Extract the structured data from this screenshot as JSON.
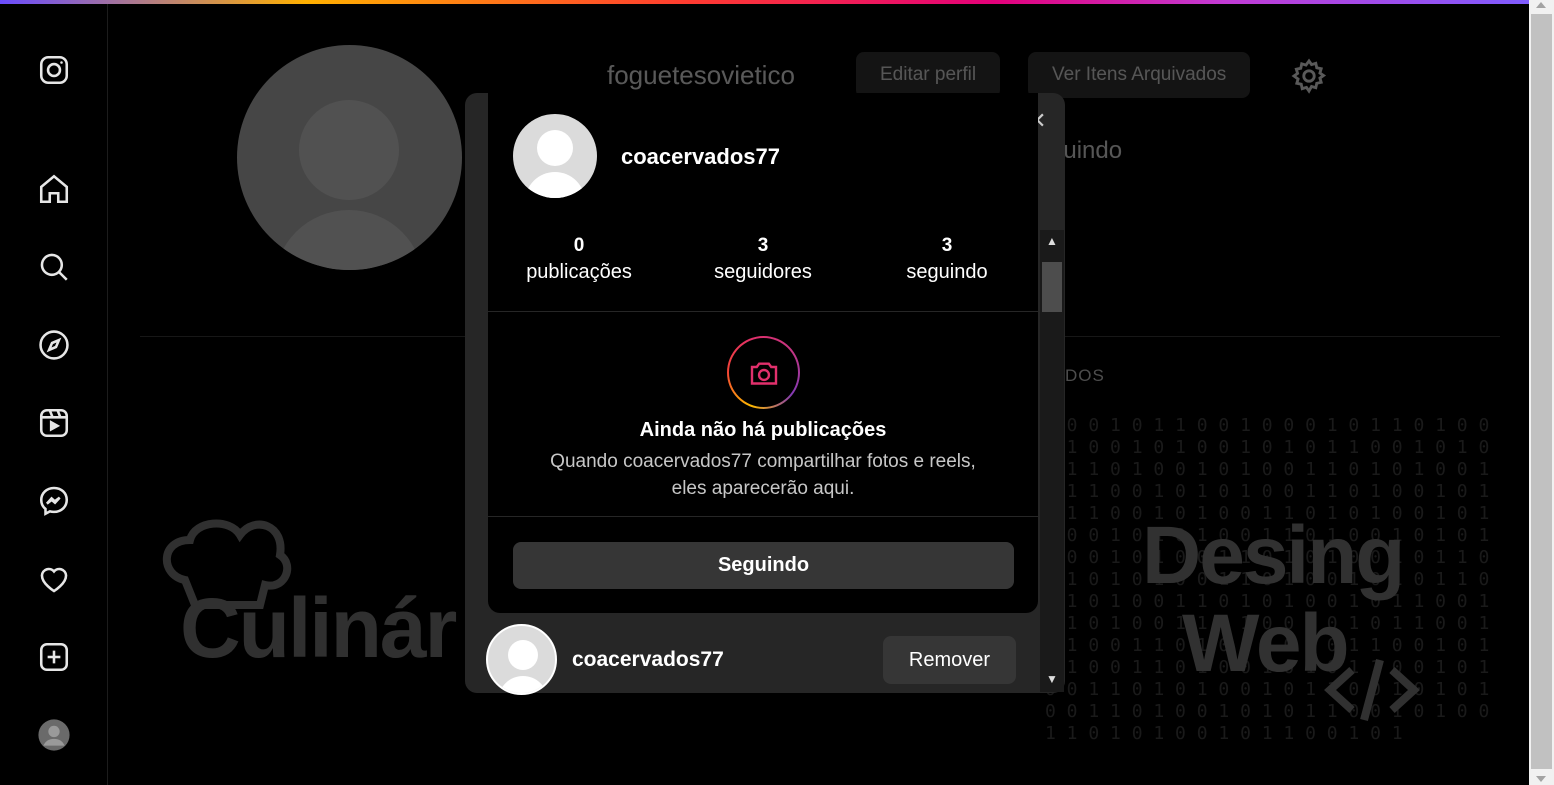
{
  "sidebar": {
    "items": [
      {
        "name": "instagram-logo-icon"
      },
      {
        "name": "home-icon"
      },
      {
        "name": "search-icon"
      },
      {
        "name": "explore-compass-icon"
      },
      {
        "name": "reels-icon"
      },
      {
        "name": "messenger-icon"
      },
      {
        "name": "heart-icon"
      },
      {
        "name": "create-plus-icon"
      },
      {
        "name": "profile-avatar"
      }
    ]
  },
  "profile": {
    "username": "foguetesovietico",
    "edit_button": "Editar perfil",
    "archive_button": "Ver Itens Arquivados",
    "following_fragment": "guindo",
    "tab_fragment": "DOS"
  },
  "background_art": {
    "left_logo_text": "Culinár",
    "right_logo_line1": "Desing",
    "right_logo_line2": "Web",
    "binary_text": "1 0 0 1 0 1 1 0 0 1 0 0 0 1 0 1 1 0 1 0 0 1 1 0 0 1 0 1 0 0 1 0 1 0 1 1 0 0 1 0 1 0 0 1 1 0 1 0 0 1 0 1 0 0 1 1 0 1 0 1 0 0 1 0 1 1 0 0 1 0 1 0 1 0 0 1 1 0 1 0 0 1 0 1 0 1 1 0 0 1 0 1 0 0 1 1 0 1 0 1 0 0 1 0 1 1 0 0 1 0 1 0 1 0 0 1 1 0 1 0 0 1 0 1 0 1 1 0 0 1 0 1 0 0 1 1 0 1 0 1 0 0 1 0 1 1 0 0 1 0 1 0 1 0 0 1 1 0 1 0 0 1 0 1 0 1 1 0 0 1 0 1 0 0 1 1 0 1 0 1 0 0 1 0 1 1 0 0 1 0 1 0 1 0 0 1 1 0 1 0 0 1 0 1 0 1 1 0 0 1 0 1 0 0 1 1 0 1 0 1 0 0 1 0 1 1 0 0 1 0 1 0 1 0 0 1 1 0 1 0 0 1 0 1 0 1 1 0 0 1 0 1 0 0 1 1 0 1 0 1 0 0 1 0 1 1 0 0 1 0 1 0 1 0 0 1 1 0 1 0 0 1 0 1 0 1 1 0 0 1 0 1 0 0 1 1 0 1 0 1 0 0 1 0 1 1 0 0 1 0 1"
  },
  "hover_card": {
    "username": "coacervados77",
    "stats": [
      {
        "num": "0",
        "label": "publicações"
      },
      {
        "num": "3",
        "label": "seguidores"
      },
      {
        "num": "3",
        "label": "seguindo"
      }
    ],
    "empty_title": "Ainda não há publicações",
    "empty_desc_line1": "Quando coacervados77 compartilhar fotos e reels,",
    "empty_desc_line2": "eles aparecerão aqui.",
    "follow_button": "Seguindo"
  },
  "followers_list": {
    "rows": [
      {
        "username": "coacervados77",
        "action": "Remover"
      }
    ]
  },
  "colors": {
    "background": "#000000",
    "card_button": "#363636",
    "modal": "#262626"
  }
}
